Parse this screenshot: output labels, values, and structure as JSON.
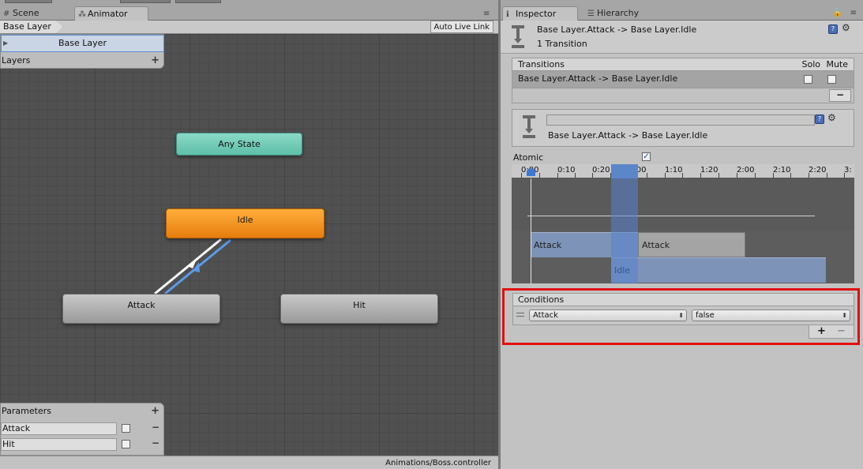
{
  "left_tabs": [
    {
      "label": "Scene",
      "icon": "grid-icon"
    },
    {
      "label": "Animator",
      "icon": "animator-icon"
    }
  ],
  "breadcrumb": "Base Layer",
  "auto_live_link": "Auto Live Link",
  "layers": {
    "selected": "Base Layer",
    "header": "Layers",
    "add": "+"
  },
  "states": {
    "any_state": "Any State",
    "idle": "Idle",
    "attack": "Attack",
    "hit": "Hit"
  },
  "colors": {
    "any_state": "#6ccbb5",
    "default_state": "#f28d1d",
    "state": "#b3b3b3",
    "transition_selected": "#5b9be8",
    "highlight": "#e01010"
  },
  "parameters": {
    "header": "Parameters",
    "add": "+",
    "items": [
      {
        "name": "Attack",
        "remove": "−"
      },
      {
        "name": "Hit",
        "remove": "−"
      }
    ]
  },
  "controller_path": "Animations/Boss.controller",
  "right_tabs": [
    {
      "label": "Inspector",
      "icon": "info-icon"
    },
    {
      "label": "Hierarchy",
      "icon": "list-icon"
    }
  ],
  "inspector": {
    "title": "Base Layer.Attack -> Base Layer.Idle",
    "subtitle": "1 Transition",
    "transitions_header": "Transitions",
    "solo": "Solo",
    "mute": "Mute",
    "transition_row": "Base Layer.Attack -> Base Layer.Idle",
    "remove": "−",
    "detail_title": "Base Layer.Attack -> Base Layer.Idle",
    "atomic_label": "Atomic",
    "atomic_mark": "✓"
  },
  "timeline": {
    "ticks": [
      "0:00",
      "0:10",
      "0:20",
      "1:00",
      "1:10",
      "1:20",
      "2:00",
      "2:10",
      "2:20",
      "3:"
    ],
    "clips": {
      "attack_1": "Attack",
      "attack_2": "Attack",
      "idle": "Idle"
    }
  },
  "conditions": {
    "header": "Conditions",
    "parameter": "Attack",
    "value": "false",
    "add": "+",
    "remove": "−"
  }
}
